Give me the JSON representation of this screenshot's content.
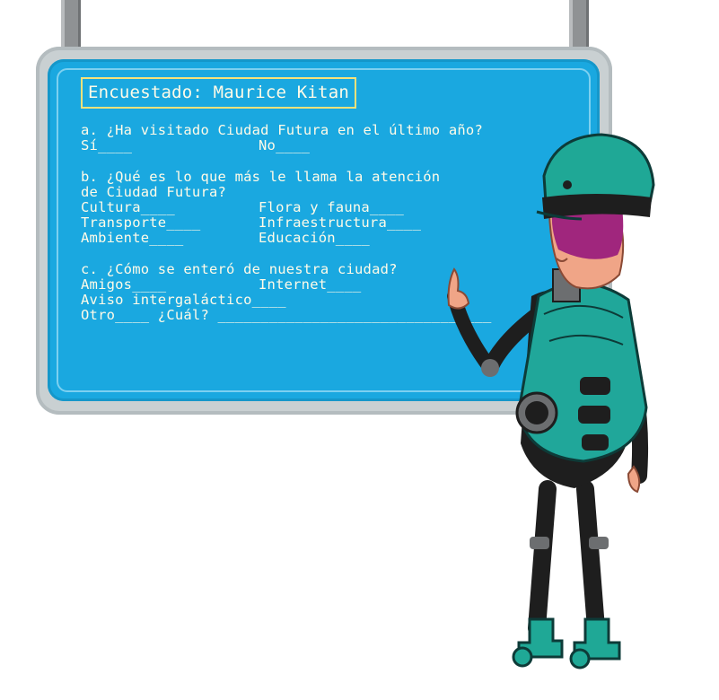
{
  "board": {
    "title": "Encuestado: Maurice Kitan",
    "questions": [
      {
        "prompt_lines": [
          "a. ¿Ha visitado Ciudad Futura en el último año?"
        ],
        "rows": [
          [
            "Sí____",
            "No____"
          ]
        ]
      },
      {
        "prompt_lines": [
          "b. ¿Qué es lo que más le llama la atención",
          "de Ciudad Futura?"
        ],
        "rows": [
          [
            "Cultura____",
            "Flora y fauna____"
          ],
          [
            "Transporte____",
            "Infraestructura____"
          ],
          [
            "Ambiente____",
            "Educación____"
          ]
        ]
      },
      {
        "prompt_lines": [
          "c. ¿Cómo se enteró de nuestra ciudad?"
        ],
        "rows": [
          [
            "Amigos____",
            "Internet____"
          ],
          [
            "Aviso intergaláctico____"
          ],
          [
            "Otro____ ¿Cuál? ________________________________"
          ]
        ]
      }
    ]
  },
  "colors": {
    "screen": "#1aa8e0",
    "frame": "#c9d0d2",
    "text": "#fffbe8",
    "title_border": "#f6e27a",
    "hat": "#1fa896",
    "hair": "#a0267d",
    "backpack": "#20a79a"
  }
}
